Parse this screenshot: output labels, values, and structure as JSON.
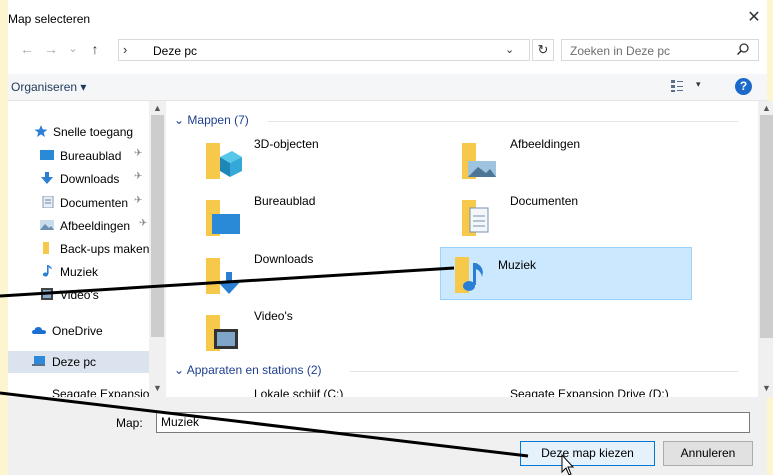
{
  "window": {
    "title": "Map selecteren",
    "close_glyph": "✕"
  },
  "nav_buttons": {
    "back": "←",
    "forward": "→",
    "recent": "⌄",
    "up": "↑"
  },
  "address": {
    "chevron": "›",
    "path": "Deze pc",
    "dropdown": "⌄",
    "refresh": "↻"
  },
  "search": {
    "placeholder": "Zoeken in Deze pc",
    "icon": "search-icon"
  },
  "toolbar": {
    "organise": "Organiseren ▾",
    "help": "?",
    "view_dropdown": "▾"
  },
  "sidebar": {
    "items": [
      {
        "label": "Snelle toegang",
        "icon": "star-icon",
        "pinned": false
      },
      {
        "label": "Bureaublad",
        "icon": "desktop-icon",
        "pinned": true
      },
      {
        "label": "Downloads",
        "icon": "download-arrow-icon",
        "pinned": true
      },
      {
        "label": "Documenten",
        "icon": "document-icon",
        "pinned": true
      },
      {
        "label": "Afbeeldingen",
        "icon": "pictures-icon",
        "pinned": true
      },
      {
        "label": "Back-ups maken",
        "icon": "folder-icon",
        "pinned": false
      },
      {
        "label": "Muziek",
        "icon": "music-note-icon",
        "pinned": false
      },
      {
        "label": "Video's",
        "icon": "video-icon",
        "pinned": false
      },
      {
        "label": "OneDrive",
        "icon": "cloud-icon",
        "pinned": false
      },
      {
        "label": "Deze pc",
        "icon": "computer-icon",
        "pinned": false,
        "selected": true
      },
      {
        "label": "Seagate Expansion",
        "icon": "drive-icon",
        "pinned": false
      }
    ],
    "pin_glyph": "✈"
  },
  "main": {
    "folders_header": "Mappen (7)",
    "folders": [
      {
        "label": "3D-objecten",
        "icon": "3d-objects-folder-icon"
      },
      {
        "label": "Afbeeldingen",
        "icon": "pictures-folder-icon"
      },
      {
        "label": "Bureaublad",
        "icon": "desktop-folder-icon"
      },
      {
        "label": "Documenten",
        "icon": "documents-folder-icon"
      },
      {
        "label": "Downloads",
        "icon": "downloads-folder-icon"
      },
      {
        "label": "Muziek",
        "icon": "music-folder-icon",
        "selected": true
      },
      {
        "label": "Video's",
        "icon": "videos-folder-icon"
      }
    ],
    "drives_header": "Apparaten en stations (2)",
    "drives": [
      {
        "label": "Lokale schijf (C:)"
      },
      {
        "label": "Seagate Expansion Drive (D:)"
      }
    ]
  },
  "footer": {
    "map_label": "Map:",
    "map_value": "Muziek",
    "choose_label": "Deze map kiezen",
    "cancel_label": "Annuleren"
  },
  "colors": {
    "accent": "#0078d7",
    "selection": "#cce8ff",
    "frame": "#fdf5cf",
    "header_link": "#1e3f8f",
    "folder": "#f7c94b"
  }
}
